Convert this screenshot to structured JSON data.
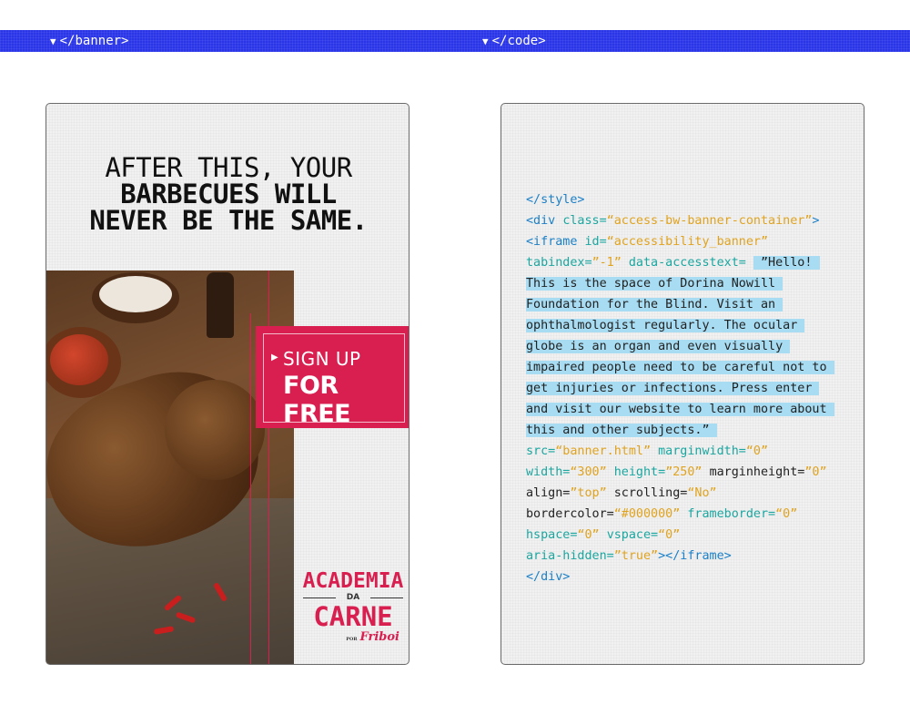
{
  "topbar": {
    "left_label": "</banner>",
    "right_label": "</code>",
    "color": "#2b35e8"
  },
  "banner": {
    "headline_line1": "AFTER THIS, YOUR",
    "headline_line2": "BARBECUES WILL",
    "headline_line3": "NEVER BE THE SAME.",
    "cta_line1": "SIGN UP",
    "cta_line2": "FOR FREE",
    "cta_color": "#d91f50",
    "brand_line1": "ACADEMIA",
    "brand_line2": "DA",
    "brand_line3": "CARNE",
    "brand_by": "POR",
    "brand_sub": "Friboi"
  },
  "code": {
    "lines": [
      [
        {
          "t": "</style>",
          "c": "tag"
        }
      ],
      [
        {
          "t": "<div ",
          "c": "tag"
        },
        {
          "t": "class=",
          "c": "attr"
        },
        {
          "t": "“access-bw-banner-container”",
          "c": "str"
        },
        {
          "t": ">",
          "c": "tag"
        }
      ],
      [
        {
          "t": "<iframe ",
          "c": "tag"
        },
        {
          "t": "id=",
          "c": "attr"
        },
        {
          "t": "“accessibility_banner”",
          "c": "str"
        }
      ],
      [
        {
          "t": "tabindex=",
          "c": "attr"
        },
        {
          "t": "”-1” ",
          "c": "str"
        },
        {
          "t": "data-accesstext= ",
          "c": "attr"
        },
        {
          "t": " ”Hello! ",
          "c": "hl"
        }
      ],
      [
        {
          "t": "This is the space of Dorina Nowill ",
          "c": "hl"
        }
      ],
      [
        {
          "t": "Foundation for the Blind. Visit an ",
          "c": "hl"
        }
      ],
      [
        {
          "t": "ophthalmologist regularly. The ocular ",
          "c": "hl"
        }
      ],
      [
        {
          "t": "globe is an organ and even visually ",
          "c": "hl"
        }
      ],
      [
        {
          "t": "impaired people need to be careful not to ",
          "c": "hl"
        }
      ],
      [
        {
          "t": "get injuries or infections. Press enter ",
          "c": "hl"
        }
      ],
      [
        {
          "t": "and visit our website to learn more about ",
          "c": "hl"
        }
      ],
      [
        {
          "t": "this and other subjects.” ",
          "c": "hl"
        }
      ],
      [
        {
          "t": "src=",
          "c": "attr"
        },
        {
          "t": "“banner.html” ",
          "c": "str"
        },
        {
          "t": "marginwidth=",
          "c": "attr"
        },
        {
          "t": "“0”",
          "c": "str"
        }
      ],
      [
        {
          "t": "width=",
          "c": "attr"
        },
        {
          "t": "“300” ",
          "c": "str"
        },
        {
          "t": "height=",
          "c": "attr"
        },
        {
          "t": "”250” ",
          "c": "str"
        },
        {
          "t": "marginheight=",
          "c": "plain"
        },
        {
          "t": "”0”",
          "c": "str"
        }
      ],
      [
        {
          "t": "align=",
          "c": "plain"
        },
        {
          "t": "”top” ",
          "c": "str"
        },
        {
          "t": "scrolling=",
          "c": "plain"
        },
        {
          "t": "“No”",
          "c": "str"
        }
      ],
      [
        {
          "t": "bordercolor=",
          "c": "plain"
        },
        {
          "t": "“#000000” ",
          "c": "str"
        },
        {
          "t": "frameborder=",
          "c": "attr"
        },
        {
          "t": "“0”",
          "c": "str"
        }
      ],
      [
        {
          "t": "hspace=",
          "c": "attr"
        },
        {
          "t": "“0” ",
          "c": "str"
        },
        {
          "t": "vspace=",
          "c": "attr"
        },
        {
          "t": "“0”",
          "c": "str"
        }
      ],
      [
        {
          "t": "aria-hidden=",
          "c": "attr"
        },
        {
          "t": "”true”",
          "c": "str"
        },
        {
          "t": "></iframe>",
          "c": "tag"
        }
      ],
      [
        {
          "t": "</div>",
          "c": "tag"
        }
      ]
    ]
  }
}
